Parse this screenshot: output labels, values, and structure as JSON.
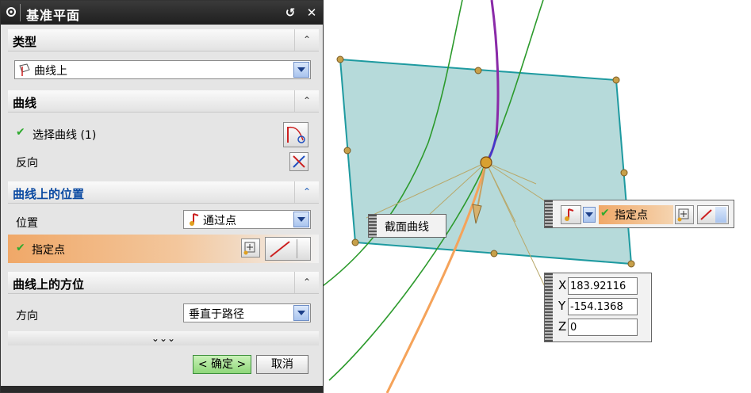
{
  "dialog": {
    "title": "基准平面",
    "title_buttons": {
      "reset": "↺",
      "close": "✕"
    },
    "sections": {
      "type": {
        "label": "类型",
        "combo_value": "曲线上"
      },
      "curve": {
        "label": "曲线",
        "select_curve": "选择曲线 (1)",
        "reverse": "反向"
      },
      "position": {
        "label": "曲线上的位置",
        "position_label": "位置",
        "position_value": "通过点",
        "specify_point": "指定点"
      },
      "orientation": {
        "label": "曲线上的方位",
        "direction_label": "方向",
        "direction_value": "垂直于路径"
      }
    },
    "more": "⌄⌄⌄",
    "ok_label": "< 确定 >",
    "cancel_label": "取消"
  },
  "viewport": {
    "section_curve_tag": "截面曲线",
    "point_toolbar_label": "指定点",
    "coords": {
      "x_label": "X",
      "x_value": "183.92116",
      "y_label": "Y",
      "y_value": "-154.1368",
      "z_label": "Z",
      "z_value": "0"
    }
  },
  "colors": {
    "plane_fill": "#9fcfcf",
    "plane_edge": "#1e9aa0",
    "title_bar": "#2a2a2a",
    "accent_orange": "#f0a868",
    "ok_green": "#8fd77a"
  }
}
